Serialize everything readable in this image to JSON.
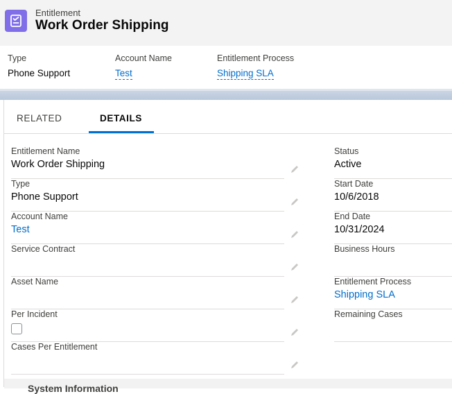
{
  "header": {
    "object_label": "Entitlement",
    "record_title": "Work Order Shipping",
    "icon": "entitlement-icon",
    "icon_color": "#7f6ee8"
  },
  "highlights": [
    {
      "label": "Type",
      "value": "Phone Support",
      "is_link": false
    },
    {
      "label": "Account Name",
      "value": "Test",
      "is_link": true
    },
    {
      "label": "Entitlement Process",
      "value": "Shipping SLA",
      "is_link": true
    }
  ],
  "tabs": [
    {
      "label": "RELATED",
      "active": false
    },
    {
      "label": "DETAILS",
      "active": true
    }
  ],
  "details": {
    "left": [
      {
        "label": "Entitlement Name",
        "value": "Work Order Shipping",
        "type": "text"
      },
      {
        "label": "Type",
        "value": "Phone Support",
        "type": "text"
      },
      {
        "label": "Account Name",
        "value": "Test",
        "type": "link"
      },
      {
        "label": "Service Contract",
        "value": "",
        "type": "text"
      },
      {
        "label": "Asset Name",
        "value": "",
        "type": "text"
      },
      {
        "label": "Per Incident",
        "value": "",
        "type": "checkbox",
        "checked": false
      },
      {
        "label": "Cases Per Entitlement",
        "value": "",
        "type": "text"
      }
    ],
    "right": [
      {
        "label": "Status",
        "value": "Active",
        "type": "text"
      },
      {
        "label": "Start Date",
        "value": "10/6/2018",
        "type": "text"
      },
      {
        "label": "End Date",
        "value": "10/31/2024",
        "type": "text"
      },
      {
        "label": "Business Hours",
        "value": "",
        "type": "text"
      },
      {
        "label": "Entitlement Process",
        "value": "Shipping SLA",
        "type": "link"
      },
      {
        "label": "Remaining Cases",
        "value": "",
        "type": "text"
      }
    ]
  },
  "section": {
    "title": "System Information"
  },
  "colors": {
    "link": "#006dcc",
    "active_tab": "#0070d2"
  }
}
